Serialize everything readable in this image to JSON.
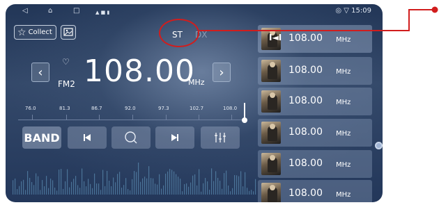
{
  "status_bar": {
    "nav_back_icon": "◁",
    "nav_home_icon": "⌂",
    "nav_recent_icon": "□",
    "notif_icons": "▲ ■ ▮",
    "right_text": "◎ ▽ 15:09"
  },
  "header": {
    "collect_label": "Collect",
    "st_label": "ST",
    "dx_label": "DX"
  },
  "tuner": {
    "band": "FM2",
    "frequency": "108.00",
    "unit": "MHz",
    "prev_arrow": "‹",
    "next_arrow": "›",
    "heart": "♡"
  },
  "scale": {
    "labels": [
      "76.0",
      "81.3",
      "86.7",
      "92.0",
      "97.3",
      "102.7",
      "108.0"
    ],
    "position_fraction": 1.0
  },
  "controls": {
    "band_label": "BAND",
    "prev_icon": "⏮",
    "search_icon": "⌕",
    "next_icon": "⏭",
    "eq_icon": "⫵"
  },
  "presets": [
    {
      "freq": "108.00",
      "unit": "MHz",
      "playing": true
    },
    {
      "freq": "108.00",
      "unit": "MHz",
      "playing": false
    },
    {
      "freq": "108.00",
      "unit": "MHz",
      "playing": false
    },
    {
      "freq": "108.00",
      "unit": "MHz",
      "playing": false
    },
    {
      "freq": "108.00",
      "unit": "MHz",
      "playing": false
    },
    {
      "freq": "108.00",
      "unit": "MHz",
      "playing": false
    }
  ],
  "colors": {
    "background": "#2b3f60",
    "annotation": "#d11d1d",
    "text": "#ffffff"
  }
}
